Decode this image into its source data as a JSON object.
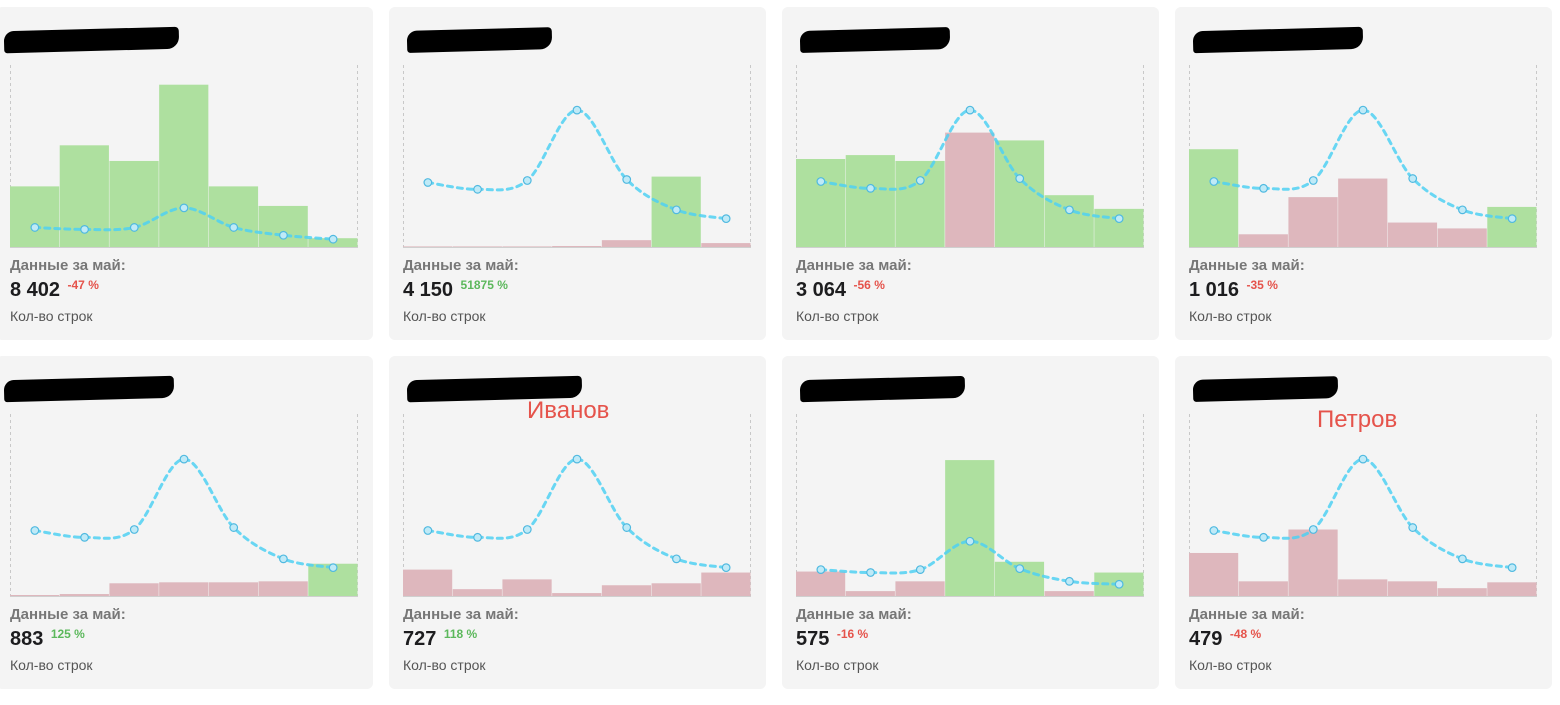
{
  "colors": {
    "bar_up": "#aee09f",
    "bar_down": "#deb7bd",
    "trend": "#4fd0f2",
    "negative": "#e5534b",
    "positive": "#5cb85c"
  },
  "chart_data": [
    {
      "type": "bar",
      "series": [
        {
          "values": [
            62,
            104,
            88,
            166,
            62,
            42,
            9
          ],
          "trend": [
            "up",
            "up",
            "up",
            "up",
            "up",
            "up",
            "up"
          ]
        },
        {
          "values": [
            20,
            18,
            20,
            40,
            20,
            12,
            8
          ],
          "style": "dotted-line"
        }
      ],
      "ylim": [
        0,
        180
      ],
      "grid": true
    },
    {
      "type": "bar",
      "series": [
        {
          "values": [
            0,
            0,
            0,
            1,
            7,
            72,
            4
          ],
          "trend": [
            "down",
            "down",
            "down",
            "down",
            "down",
            "up",
            "down"
          ]
        },
        {
          "values": [
            66,
            59,
            68,
            140,
            69,
            38,
            29
          ],
          "style": "dotted-line"
        }
      ],
      "ylim": [
        0,
        180
      ],
      "grid": true
    },
    {
      "type": "bar",
      "series": [
        {
          "values": [
            90,
            94,
            88,
            117,
            109,
            53,
            39
          ],
          "trend": [
            "up",
            "up",
            "up",
            "down",
            "up",
            "up",
            "up"
          ]
        },
        {
          "values": [
            67,
            60,
            68,
            140,
            70,
            38,
            29
          ],
          "style": "dotted-line"
        }
      ],
      "ylim": [
        0,
        180
      ],
      "grid": true
    },
    {
      "type": "bar",
      "series": [
        {
          "values": [
            100,
            13,
            51,
            70,
            25,
            19,
            41
          ],
          "trend": [
            "up",
            "down",
            "down",
            "down",
            "down",
            "down",
            "up"
          ]
        },
        {
          "values": [
            67,
            60,
            68,
            140,
            70,
            38,
            29
          ],
          "style": "dotted-line"
        }
      ],
      "ylim": [
        0,
        180
      ],
      "grid": true
    },
    {
      "type": "bar",
      "series": [
        {
          "values": [
            1,
            2,
            13,
            14,
            14,
            15,
            33
          ],
          "trend": [
            "down",
            "down",
            "down",
            "down",
            "down",
            "down",
            "up"
          ]
        },
        {
          "values": [
            67,
            60,
            68,
            140,
            70,
            38,
            29
          ],
          "style": "dotted-line"
        }
      ],
      "ylim": [
        0,
        180
      ],
      "grid": true
    },
    {
      "type": "bar",
      "series": [
        {
          "values": [
            27,
            7,
            17,
            3,
            11,
            13,
            24
          ],
          "trend": [
            "down",
            "down",
            "down",
            "down",
            "down",
            "down",
            "down"
          ]
        },
        {
          "values": [
            67,
            60,
            68,
            140,
            70,
            38,
            29
          ],
          "style": "dotted-line"
        }
      ],
      "ylim": [
        0,
        180
      ],
      "grid": true
    },
    {
      "type": "bar",
      "series": [
        {
          "values": [
            25,
            5,
            15,
            139,
            35,
            5,
            24
          ],
          "trend": [
            "down",
            "down",
            "down",
            "up",
            "up",
            "down",
            "up"
          ]
        },
        {
          "values": [
            27,
            24,
            27,
            56,
            28,
            15,
            12
          ],
          "style": "dotted-line"
        }
      ],
      "ylim": [
        0,
        180
      ],
      "grid": true
    },
    {
      "type": "bar",
      "series": [
        {
          "values": [
            44,
            15,
            68,
            17,
            15,
            8,
            14
          ],
          "trend": [
            "down",
            "down",
            "down",
            "down",
            "down",
            "down",
            "down"
          ]
        },
        {
          "values": [
            67,
            60,
            68,
            140,
            70,
            38,
            29
          ],
          "style": "dotted-line"
        }
      ],
      "ylim": [
        0,
        180
      ],
      "grid": true
    }
  ],
  "cards": [
    {
      "label": "Данные за май:",
      "value": "8 402",
      "delta": "-47 %",
      "delta_sign": "neg",
      "caption": "Кол-во строк",
      "annotation": ""
    },
    {
      "label": "Данные за май:",
      "value": "4 150",
      "delta": "51875 %",
      "delta_sign": "pos",
      "caption": "Кол-во строк",
      "annotation": ""
    },
    {
      "label": "Данные за май:",
      "value": "3 064",
      "delta": "-56 %",
      "delta_sign": "neg",
      "caption": "Кол-во строк",
      "annotation": ""
    },
    {
      "label": "Данные за май:",
      "value": "1 016",
      "delta": "-35 %",
      "delta_sign": "neg",
      "caption": "Кол-во строк",
      "annotation": ""
    },
    {
      "label": "Данные за май:",
      "value": "883",
      "delta": "125 %",
      "delta_sign": "pos",
      "caption": "Кол-во строк",
      "annotation": ""
    },
    {
      "label": "Данные за май:",
      "value": "727",
      "delta": "118 %",
      "delta_sign": "pos",
      "caption": "Кол-во строк",
      "annotation": "Иванов"
    },
    {
      "label": "Данные за май:",
      "value": "575",
      "delta": "-16 %",
      "delta_sign": "neg",
      "caption": "Кол-во строк",
      "annotation": ""
    },
    {
      "label": "Данные за май:",
      "value": "479",
      "delta": "-48 %",
      "delta_sign": "neg",
      "caption": "Кол-во строк",
      "annotation": "Петров"
    }
  ]
}
